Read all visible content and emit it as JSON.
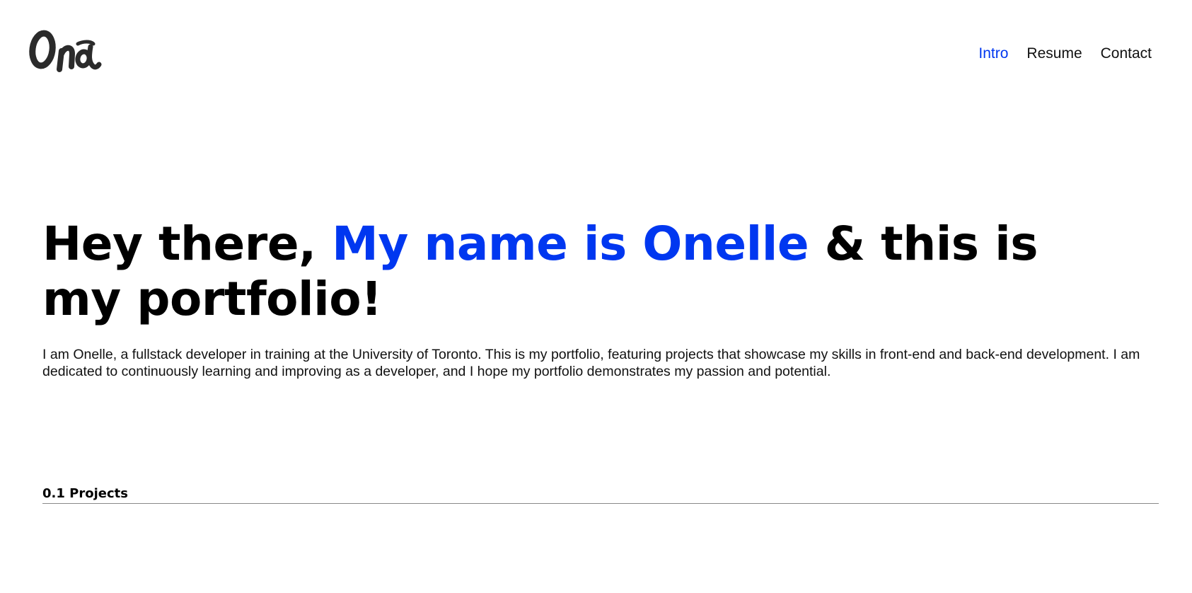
{
  "logo": {
    "text": "Ona"
  },
  "nav": {
    "items": [
      {
        "label": "Intro",
        "active": true
      },
      {
        "label": "Resume",
        "active": false
      },
      {
        "label": "Contact",
        "active": false
      }
    ]
  },
  "hero": {
    "part1": "Hey there, ",
    "highlight": "My name is Onelle",
    "part2": " & this is my portfolio!"
  },
  "intro": {
    "text": "I am Onelle, a fullstack developer in training at the University of Toronto. This is my portfolio, featuring projects that showcase my skills in front-end and back-end development. I am dedicated to continuously learning and improving as a developer, and I hope my portfolio demonstrates my passion and potential."
  },
  "projects": {
    "heading": "0.1 Projects"
  },
  "colors": {
    "accent": "#0037f0",
    "text": "#000000",
    "rule": "#8a8a8a",
    "background": "#ffffff"
  }
}
